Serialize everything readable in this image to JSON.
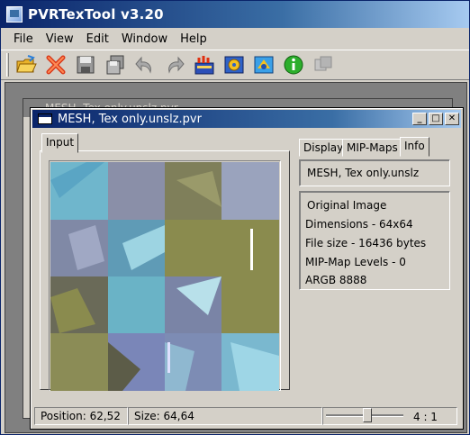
{
  "app": {
    "title": "PVRTexTool v3.20"
  },
  "menu": [
    {
      "label": "File"
    },
    {
      "label": "View"
    },
    {
      "label": "Edit"
    },
    {
      "label": "Window"
    },
    {
      "label": "Help"
    }
  ],
  "toolbar": {
    "icons": [
      "open-icon",
      "close-icon",
      "save-icon",
      "save-all-icon",
      "undo-icon",
      "redo-icon",
      "encode-icon",
      "settings-icon",
      "export-icon",
      "info-icon",
      "compare-icon"
    ]
  },
  "back_window": {
    "title": "MESH, Tex only.unslz.pvr"
  },
  "window": {
    "title": "MESH, Tex only.unslz.pvr",
    "buttons": [
      "_",
      "□",
      "✕"
    ]
  },
  "input_tab": {
    "label": "Input"
  },
  "right_tabs": [
    {
      "label": "Display"
    },
    {
      "label": "MIP-Maps"
    },
    {
      "label": "Info"
    }
  ],
  "info": {
    "texture_name": "MESH, Tex only.unslz",
    "heading": "Original Image",
    "dimensions": "Dimensions - 64x64",
    "file_size": "File size - 16436 bytes",
    "mip_levels": "MIP-Map Levels - 0",
    "format": "ARGB 8888"
  },
  "status": {
    "position": "Position: 62,52",
    "size": "Size: 64,64",
    "zoom": "4 : 1",
    "zoom_level": 0.55
  }
}
